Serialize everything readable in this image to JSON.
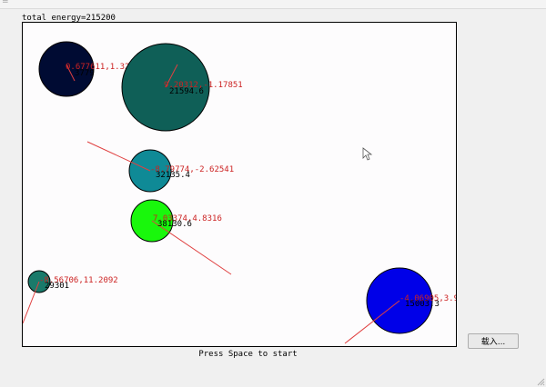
{
  "window": {
    "titlebar_glyph": "="
  },
  "energy_label": "total energy=215200",
  "hint": "Press Space to start",
  "load_button": "载入...",
  "icons": {
    "cursor": "mouse-pointer-icon",
    "grip": "resize-grip-icon"
  },
  "bodies": [
    {
      "color": "#000b33",
      "pos": "0.677611,1.32033",
      "mass": "3779",
      "vx_label": ""
    },
    {
      "color": "#0f5f57",
      "pos": "9.20312,-1.17851",
      "mass": "21594.6"
    },
    {
      "color": "#0f8a96",
      "pos": "-8.79774,-2.62541",
      "mass": "32135.4"
    },
    {
      "color": "#19f70c",
      "pos": "7.03374,4.8316",
      "mass": "38130.6"
    },
    {
      "color": "#1a7a6a",
      "pos": "-8.56706,11.2092",
      "mass": "29301"
    },
    {
      "color": "#0000e8",
      "pos": "-4.06905,3.938",
      "mass": "15003.3"
    }
  ]
}
